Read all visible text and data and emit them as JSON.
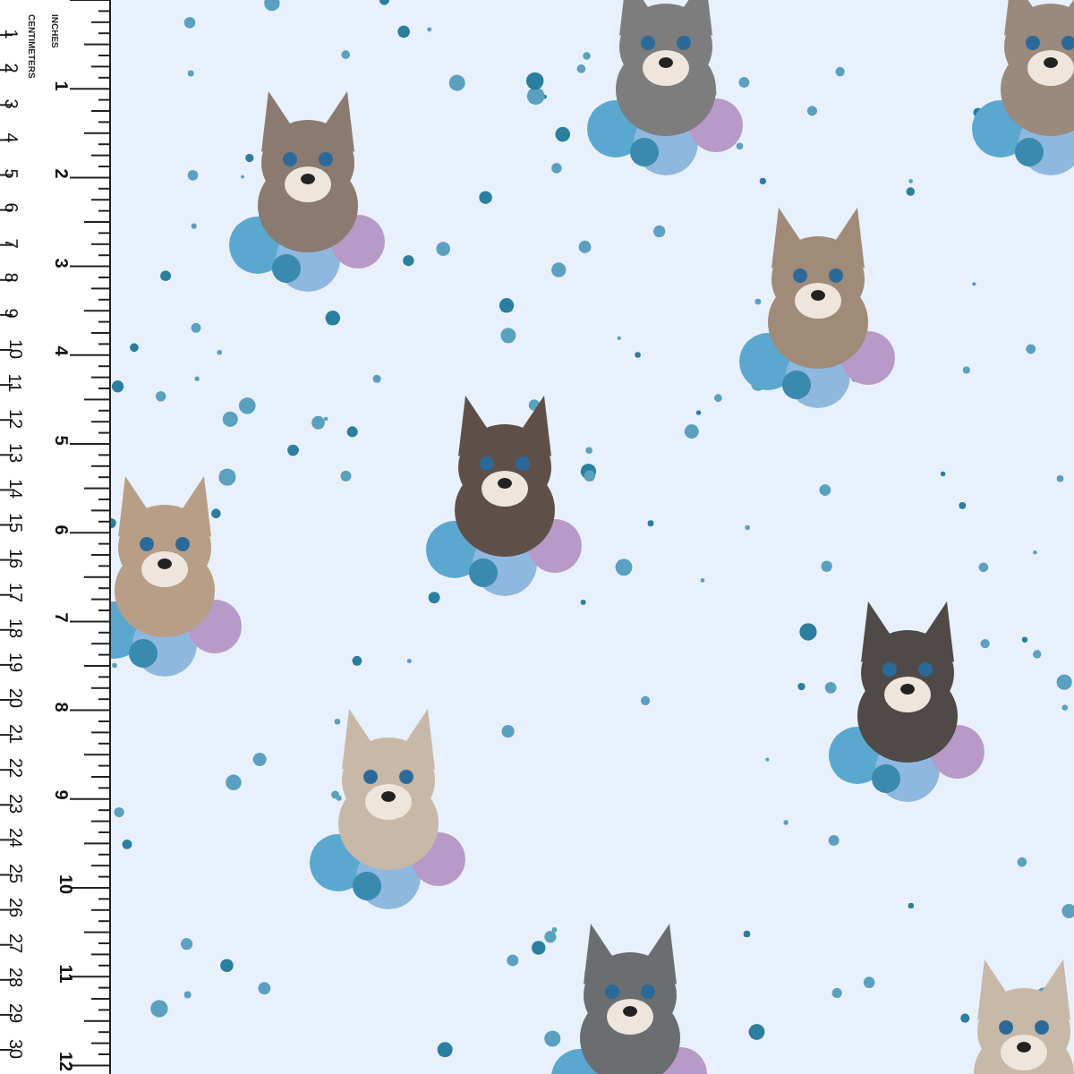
{
  "ruler": {
    "unit_labels": [
      "INCHES",
      "CENTIMETERS"
    ],
    "centimeters": [
      "1",
      "2",
      "3",
      "4",
      "5",
      "6",
      "7",
      "8",
      "9",
      "10",
      "11",
      "12",
      "13",
      "14",
      "15",
      "16",
      "17",
      "18",
      "19",
      "20",
      "21",
      "22",
      "23",
      "24",
      "25",
      "26",
      "27",
      "28",
      "29",
      "30"
    ],
    "inches": [
      "1",
      "2",
      "3",
      "4",
      "5",
      "6",
      "7",
      "8",
      "9",
      "10",
      "11",
      "12"
    ]
  }
}
